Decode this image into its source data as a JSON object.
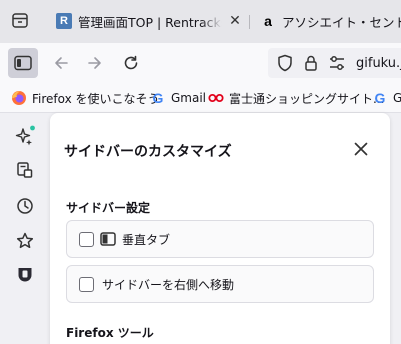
{
  "tabs": [
    {
      "favicon": "R",
      "title": "管理画面TOP | Rentracks Affiliate"
    },
    {
      "favicon": "a",
      "title": "アソシエイト・セントラル"
    }
  ],
  "navbar": {
    "url": "gifuku.j"
  },
  "bookmarks": [
    {
      "label": "Firefox を使いこなそう",
      "icon": "firefox-icon"
    },
    {
      "label": "Gmail",
      "icon": "google-icon"
    },
    {
      "label": "富士通ショッピングサイト...",
      "icon": "fujitsu-icon"
    },
    {
      "label": "Gr",
      "icon": "google-icon"
    }
  ],
  "sidebar_icons": [
    "ai-sparkle-icon",
    "synced-tabs-icon",
    "history-icon",
    "bookmark-star-icon",
    "pocket-icon"
  ],
  "panel": {
    "title": "サイドバーのカスタマイズ",
    "section_settings": "サイドバー設定",
    "options": [
      {
        "label": "垂直タブ",
        "checked": false
      },
      {
        "label": "サイドバーを右側へ移動",
        "checked": false
      }
    ],
    "section_tools": "Firefox ツール"
  },
  "colors": {
    "tabstrip": "#e6e6ea",
    "toolbar": "#f9f9fb",
    "accent_dot": "#2ac3a2",
    "sidebar_button_active": "#cfcfd8"
  }
}
